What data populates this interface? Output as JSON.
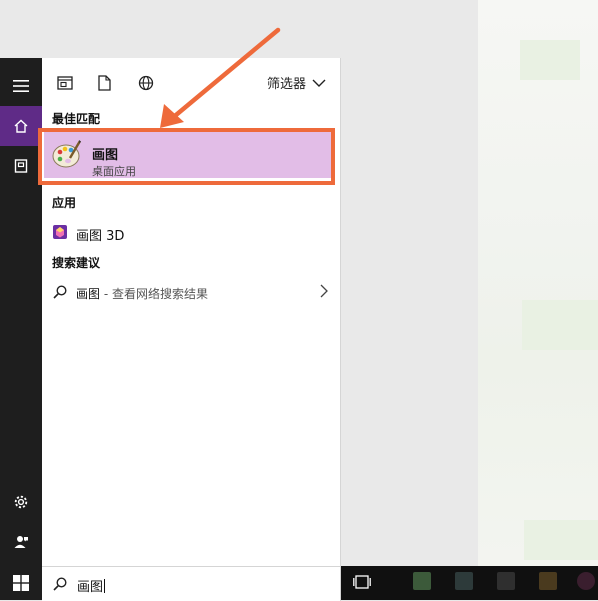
{
  "panel": {
    "filter_label": "筛选器",
    "best_match_label": "最佳匹配",
    "apps_label": "应用",
    "suggestions_label": "搜索建议"
  },
  "best_match": {
    "title": "画图",
    "subtitle": "桌面应用"
  },
  "apps": [
    {
      "name": "画图 3D"
    }
  ],
  "suggestions": [
    {
      "term": "画图",
      "rest": " - 查看网络搜索结果"
    }
  ],
  "search": {
    "value": "画图"
  },
  "colors": {
    "accent": "#5f2b87",
    "highlight": "#e2bde7",
    "annotation": "#ee6a3b"
  }
}
